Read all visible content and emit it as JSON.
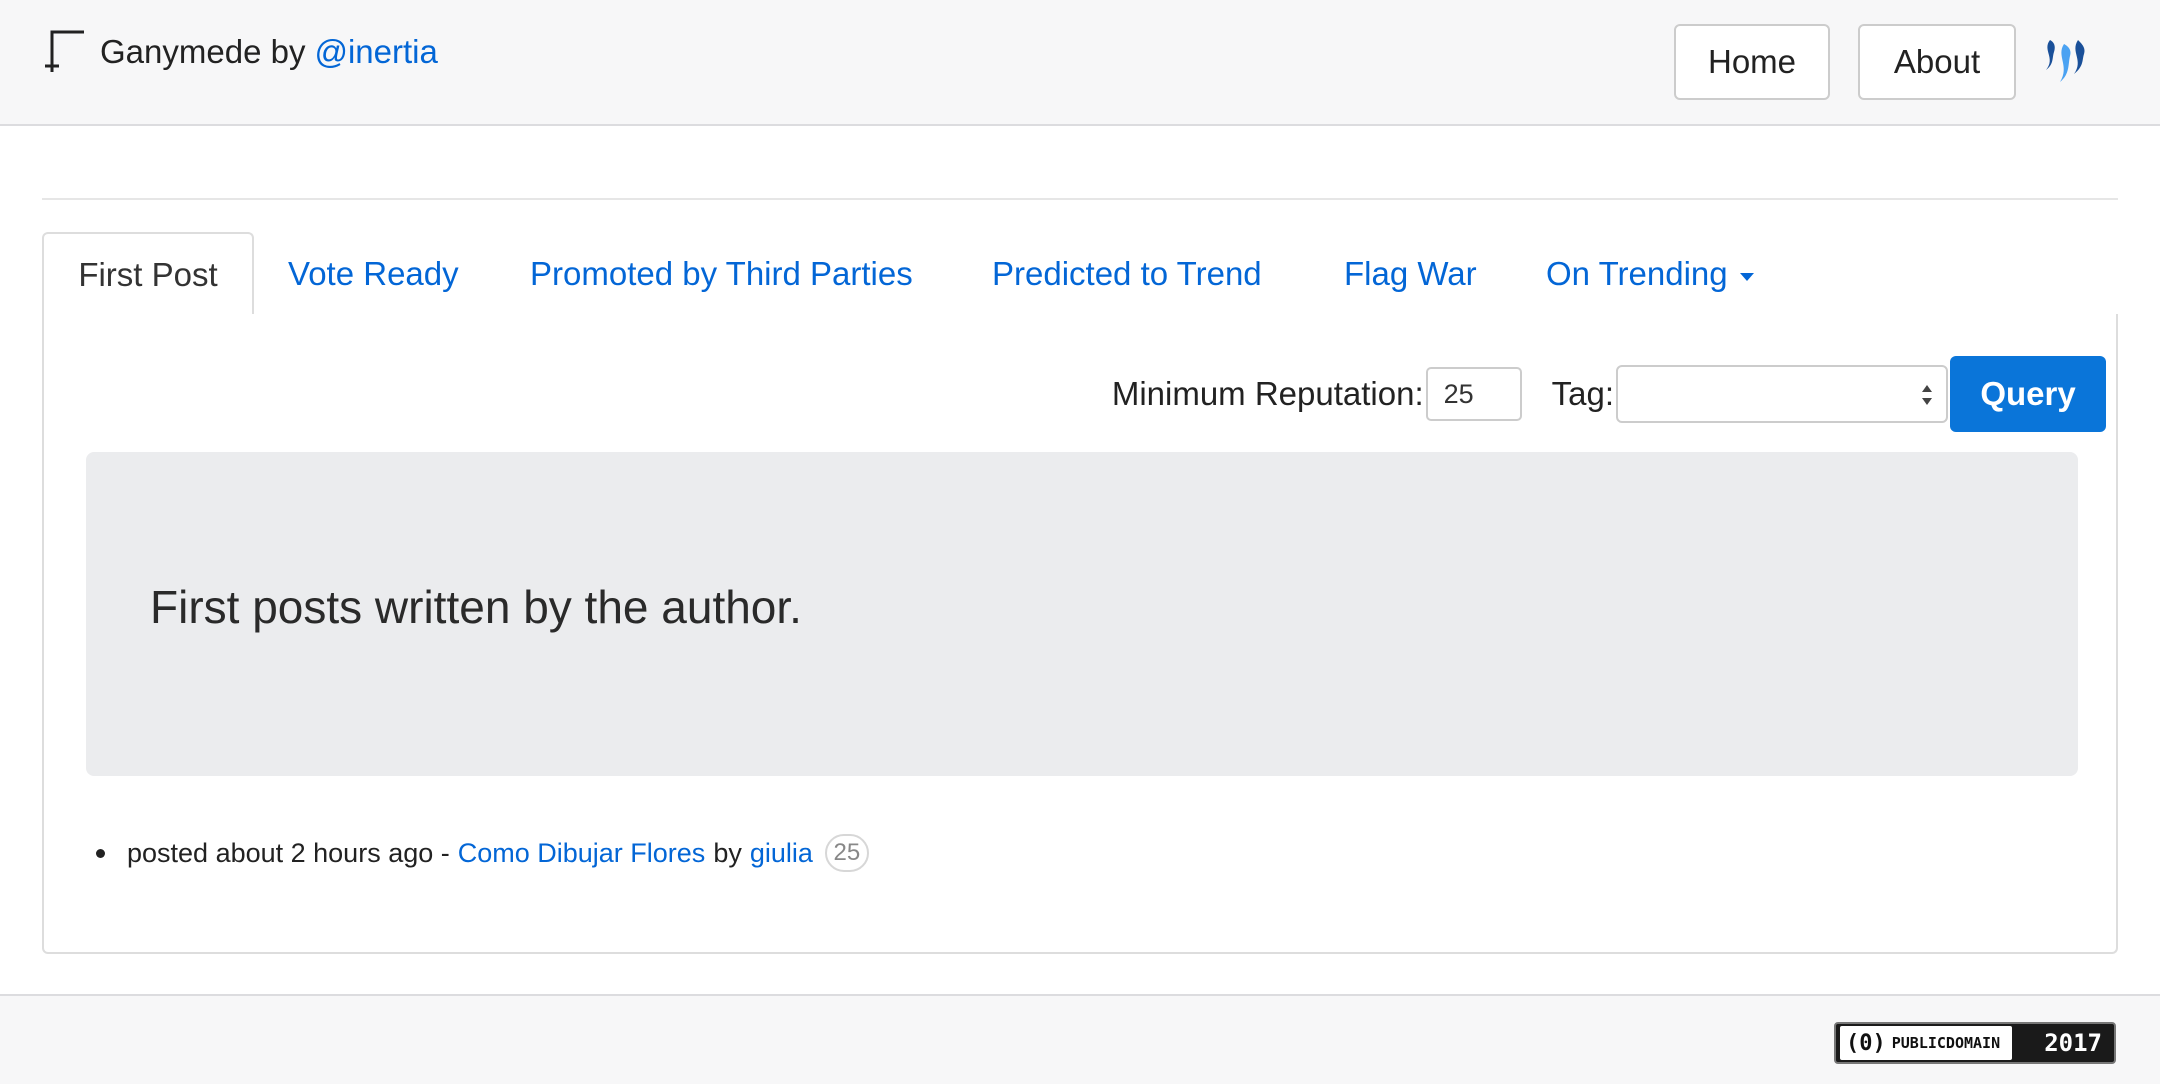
{
  "header": {
    "app_name": "Ganymede by",
    "author_link": "@inertia",
    "nav": {
      "home": "Home",
      "about": "About"
    }
  },
  "tabs": [
    {
      "label": "First Post",
      "active": true
    },
    {
      "label": "Vote Ready"
    },
    {
      "label": "Promoted by Third Parties"
    },
    {
      "label": "Predicted to Trend"
    },
    {
      "label": "Flag War"
    },
    {
      "label": "On Trending",
      "dropdown": true
    }
  ],
  "filters": {
    "min_rep_label": "Minimum Reputation:",
    "min_rep_value": "25",
    "tag_label": "Tag:",
    "tag_value": "",
    "query_label": "Query"
  },
  "jumbotron": {
    "heading": "First posts written by the author."
  },
  "posts": [
    {
      "prefix": "posted about 2 hours ago -",
      "title": "Como Dibujar Flores",
      "by": "by",
      "author": "giulia",
      "reputation": "25"
    }
  ],
  "footer": {
    "license_text": "PUBLICDOMAIN",
    "license_mark": "(0)",
    "year": "2017"
  },
  "colors": {
    "link": "#0366d6",
    "primary_button": "#0a75d9",
    "jumbotron_bg": "#ebecee"
  },
  "icons": {
    "brand": "corner-bracket-icon",
    "steem": "steem-logo-icon"
  }
}
